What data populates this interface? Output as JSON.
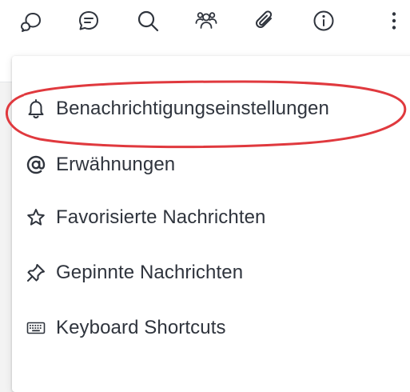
{
  "toolbar": {
    "icons": [
      {
        "name": "discussion-icon"
      },
      {
        "name": "threads-icon"
      },
      {
        "name": "search-icon"
      },
      {
        "name": "members-icon"
      },
      {
        "name": "attachment-icon"
      },
      {
        "name": "info-icon"
      },
      {
        "name": "kebab-menu-icon"
      }
    ]
  },
  "menu": {
    "items": [
      {
        "icon": "bell-icon",
        "label": "Benachrichtigungseinstellungen"
      },
      {
        "icon": "at-icon",
        "label": "Erwähnungen"
      },
      {
        "icon": "star-icon",
        "label": "Favorisierte Nachrichten"
      },
      {
        "icon": "pin-icon",
        "label": "Gepinnte Nachrichten"
      },
      {
        "icon": "keyboard-icon",
        "label": "Keyboard Shortcuts"
      }
    ]
  },
  "colors": {
    "highlight": "#e0393e",
    "text": "#2f343d",
    "icon": "#2f343d"
  }
}
